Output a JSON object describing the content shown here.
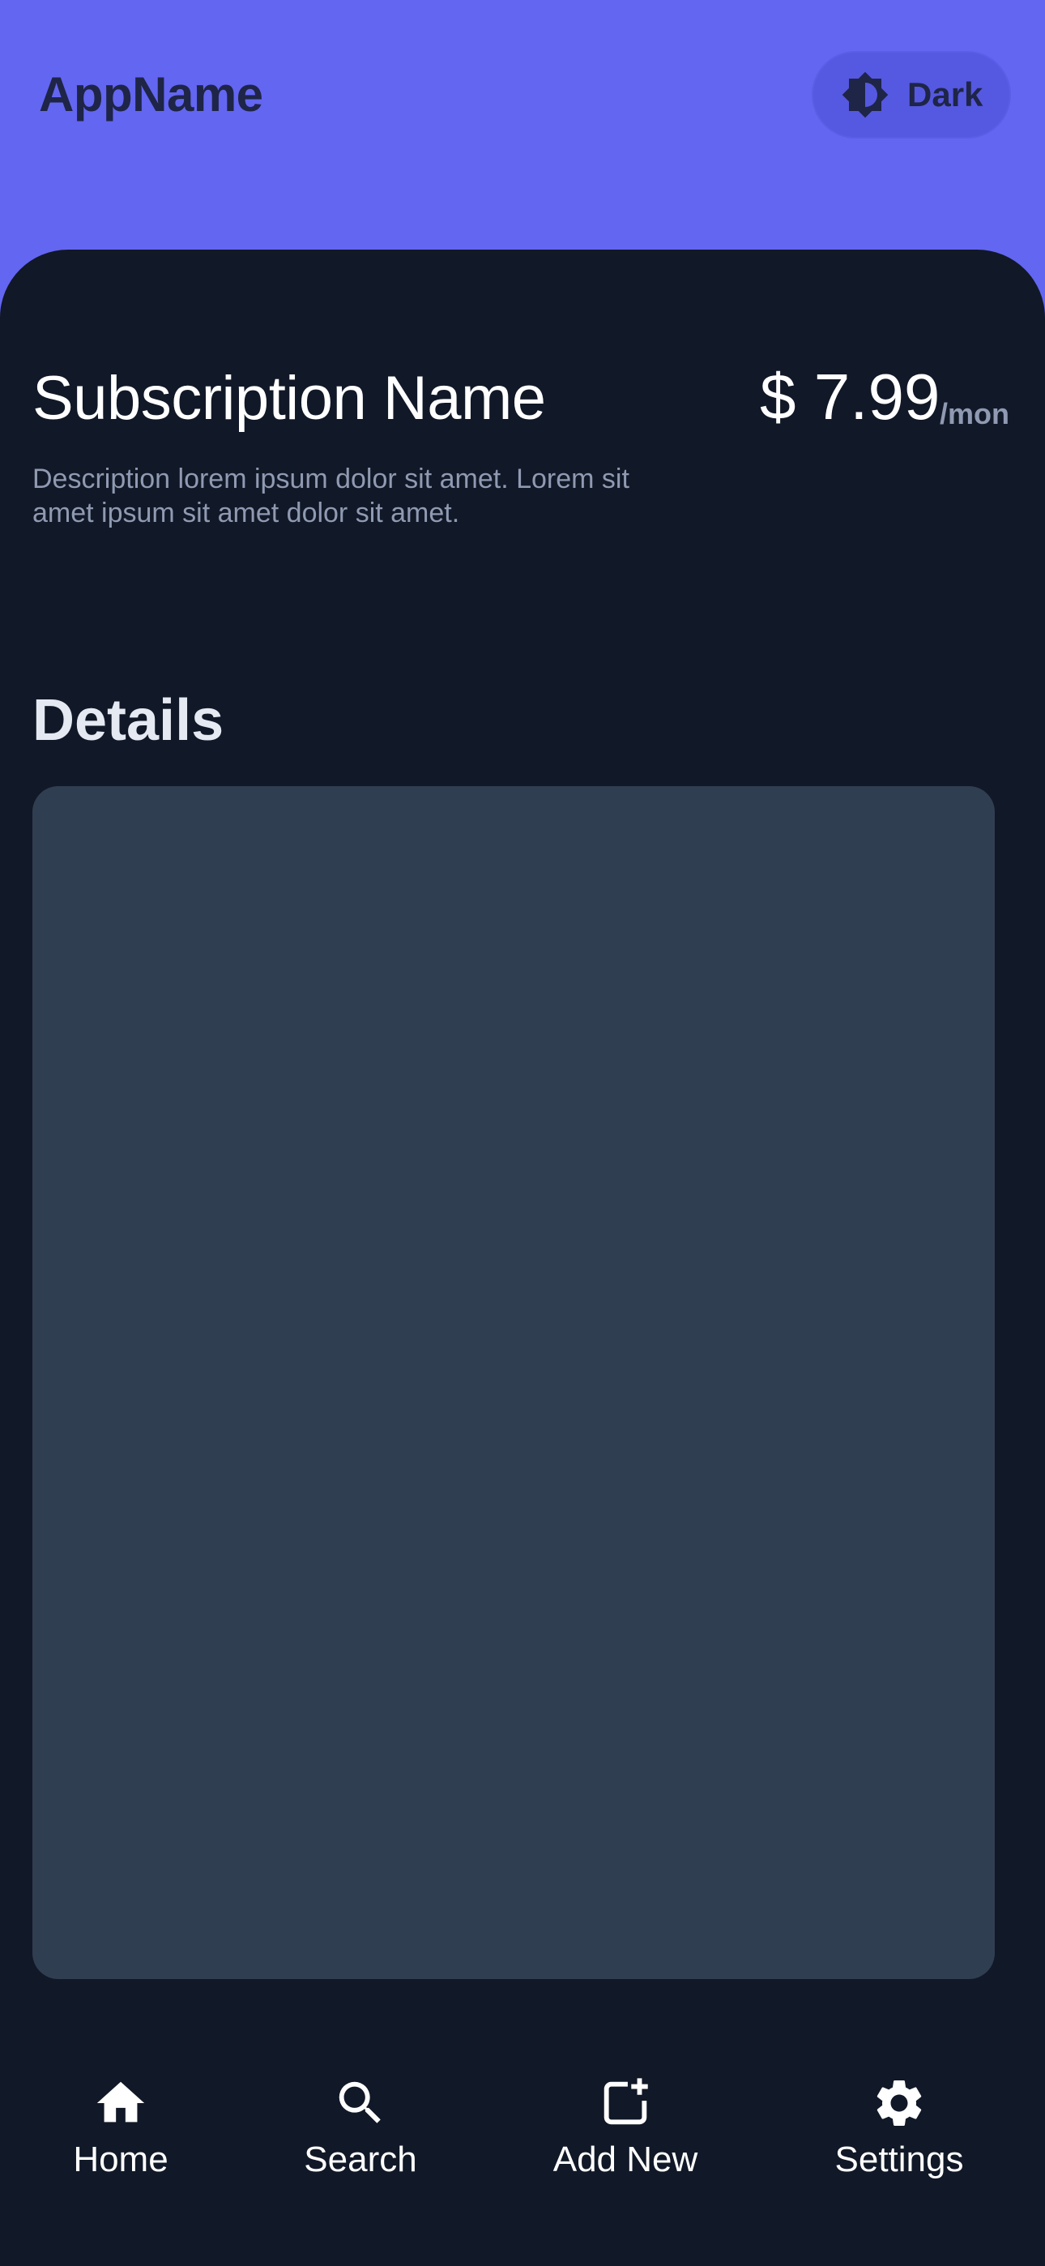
{
  "header": {
    "app_name": "AppName",
    "theme_toggle_label": "Dark",
    "theme_toggle_icon": "brightness-contrast-icon"
  },
  "subscription": {
    "name": "Subscription Name",
    "price": "$ 7.99",
    "period": "/mon",
    "description": "Description lorem ipsum dolor sit amet. Lorem sit amet ipsum sit amet dolor sit amet."
  },
  "details": {
    "heading": "Details"
  },
  "nav": {
    "items": [
      {
        "label": "Home",
        "icon": "home-icon"
      },
      {
        "label": "Search",
        "icon": "search-icon"
      },
      {
        "label": "Add New",
        "icon": "add-box-icon"
      },
      {
        "label": "Settings",
        "icon": "gear-icon"
      }
    ]
  },
  "colors": {
    "accent": "#6366f1",
    "background": "#111827",
    "card": "#303e51",
    "muted_text": "#8f9ab2",
    "header_text": "#1e2547"
  }
}
